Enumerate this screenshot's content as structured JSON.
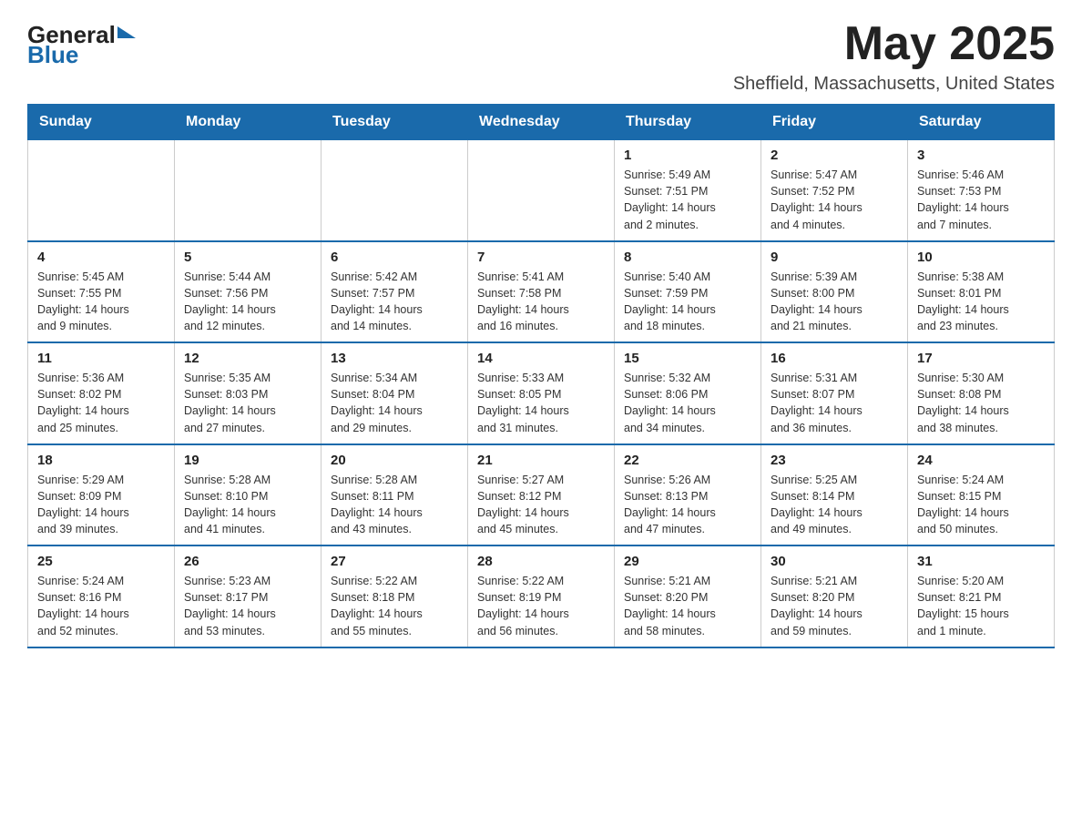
{
  "header": {
    "logo_general": "General",
    "logo_blue": "Blue",
    "month_title": "May 2025",
    "location": "Sheffield, Massachusetts, United States"
  },
  "weekdays": [
    "Sunday",
    "Monday",
    "Tuesday",
    "Wednesday",
    "Thursday",
    "Friday",
    "Saturday"
  ],
  "weeks": [
    [
      {
        "day": "",
        "info": ""
      },
      {
        "day": "",
        "info": ""
      },
      {
        "day": "",
        "info": ""
      },
      {
        "day": "",
        "info": ""
      },
      {
        "day": "1",
        "info": "Sunrise: 5:49 AM\nSunset: 7:51 PM\nDaylight: 14 hours\nand 2 minutes."
      },
      {
        "day": "2",
        "info": "Sunrise: 5:47 AM\nSunset: 7:52 PM\nDaylight: 14 hours\nand 4 minutes."
      },
      {
        "day": "3",
        "info": "Sunrise: 5:46 AM\nSunset: 7:53 PM\nDaylight: 14 hours\nand 7 minutes."
      }
    ],
    [
      {
        "day": "4",
        "info": "Sunrise: 5:45 AM\nSunset: 7:55 PM\nDaylight: 14 hours\nand 9 minutes."
      },
      {
        "day": "5",
        "info": "Sunrise: 5:44 AM\nSunset: 7:56 PM\nDaylight: 14 hours\nand 12 minutes."
      },
      {
        "day": "6",
        "info": "Sunrise: 5:42 AM\nSunset: 7:57 PM\nDaylight: 14 hours\nand 14 minutes."
      },
      {
        "day": "7",
        "info": "Sunrise: 5:41 AM\nSunset: 7:58 PM\nDaylight: 14 hours\nand 16 minutes."
      },
      {
        "day": "8",
        "info": "Sunrise: 5:40 AM\nSunset: 7:59 PM\nDaylight: 14 hours\nand 18 minutes."
      },
      {
        "day": "9",
        "info": "Sunrise: 5:39 AM\nSunset: 8:00 PM\nDaylight: 14 hours\nand 21 minutes."
      },
      {
        "day": "10",
        "info": "Sunrise: 5:38 AM\nSunset: 8:01 PM\nDaylight: 14 hours\nand 23 minutes."
      }
    ],
    [
      {
        "day": "11",
        "info": "Sunrise: 5:36 AM\nSunset: 8:02 PM\nDaylight: 14 hours\nand 25 minutes."
      },
      {
        "day": "12",
        "info": "Sunrise: 5:35 AM\nSunset: 8:03 PM\nDaylight: 14 hours\nand 27 minutes."
      },
      {
        "day": "13",
        "info": "Sunrise: 5:34 AM\nSunset: 8:04 PM\nDaylight: 14 hours\nand 29 minutes."
      },
      {
        "day": "14",
        "info": "Sunrise: 5:33 AM\nSunset: 8:05 PM\nDaylight: 14 hours\nand 31 minutes."
      },
      {
        "day": "15",
        "info": "Sunrise: 5:32 AM\nSunset: 8:06 PM\nDaylight: 14 hours\nand 34 minutes."
      },
      {
        "day": "16",
        "info": "Sunrise: 5:31 AM\nSunset: 8:07 PM\nDaylight: 14 hours\nand 36 minutes."
      },
      {
        "day": "17",
        "info": "Sunrise: 5:30 AM\nSunset: 8:08 PM\nDaylight: 14 hours\nand 38 minutes."
      }
    ],
    [
      {
        "day": "18",
        "info": "Sunrise: 5:29 AM\nSunset: 8:09 PM\nDaylight: 14 hours\nand 39 minutes."
      },
      {
        "day": "19",
        "info": "Sunrise: 5:28 AM\nSunset: 8:10 PM\nDaylight: 14 hours\nand 41 minutes."
      },
      {
        "day": "20",
        "info": "Sunrise: 5:28 AM\nSunset: 8:11 PM\nDaylight: 14 hours\nand 43 minutes."
      },
      {
        "day": "21",
        "info": "Sunrise: 5:27 AM\nSunset: 8:12 PM\nDaylight: 14 hours\nand 45 minutes."
      },
      {
        "day": "22",
        "info": "Sunrise: 5:26 AM\nSunset: 8:13 PM\nDaylight: 14 hours\nand 47 minutes."
      },
      {
        "day": "23",
        "info": "Sunrise: 5:25 AM\nSunset: 8:14 PM\nDaylight: 14 hours\nand 49 minutes."
      },
      {
        "day": "24",
        "info": "Sunrise: 5:24 AM\nSunset: 8:15 PM\nDaylight: 14 hours\nand 50 minutes."
      }
    ],
    [
      {
        "day": "25",
        "info": "Sunrise: 5:24 AM\nSunset: 8:16 PM\nDaylight: 14 hours\nand 52 minutes."
      },
      {
        "day": "26",
        "info": "Sunrise: 5:23 AM\nSunset: 8:17 PM\nDaylight: 14 hours\nand 53 minutes."
      },
      {
        "day": "27",
        "info": "Sunrise: 5:22 AM\nSunset: 8:18 PM\nDaylight: 14 hours\nand 55 minutes."
      },
      {
        "day": "28",
        "info": "Sunrise: 5:22 AM\nSunset: 8:19 PM\nDaylight: 14 hours\nand 56 minutes."
      },
      {
        "day": "29",
        "info": "Sunrise: 5:21 AM\nSunset: 8:20 PM\nDaylight: 14 hours\nand 58 minutes."
      },
      {
        "day": "30",
        "info": "Sunrise: 5:21 AM\nSunset: 8:20 PM\nDaylight: 14 hours\nand 59 minutes."
      },
      {
        "day": "31",
        "info": "Sunrise: 5:20 AM\nSunset: 8:21 PM\nDaylight: 15 hours\nand 1 minute."
      }
    ]
  ]
}
